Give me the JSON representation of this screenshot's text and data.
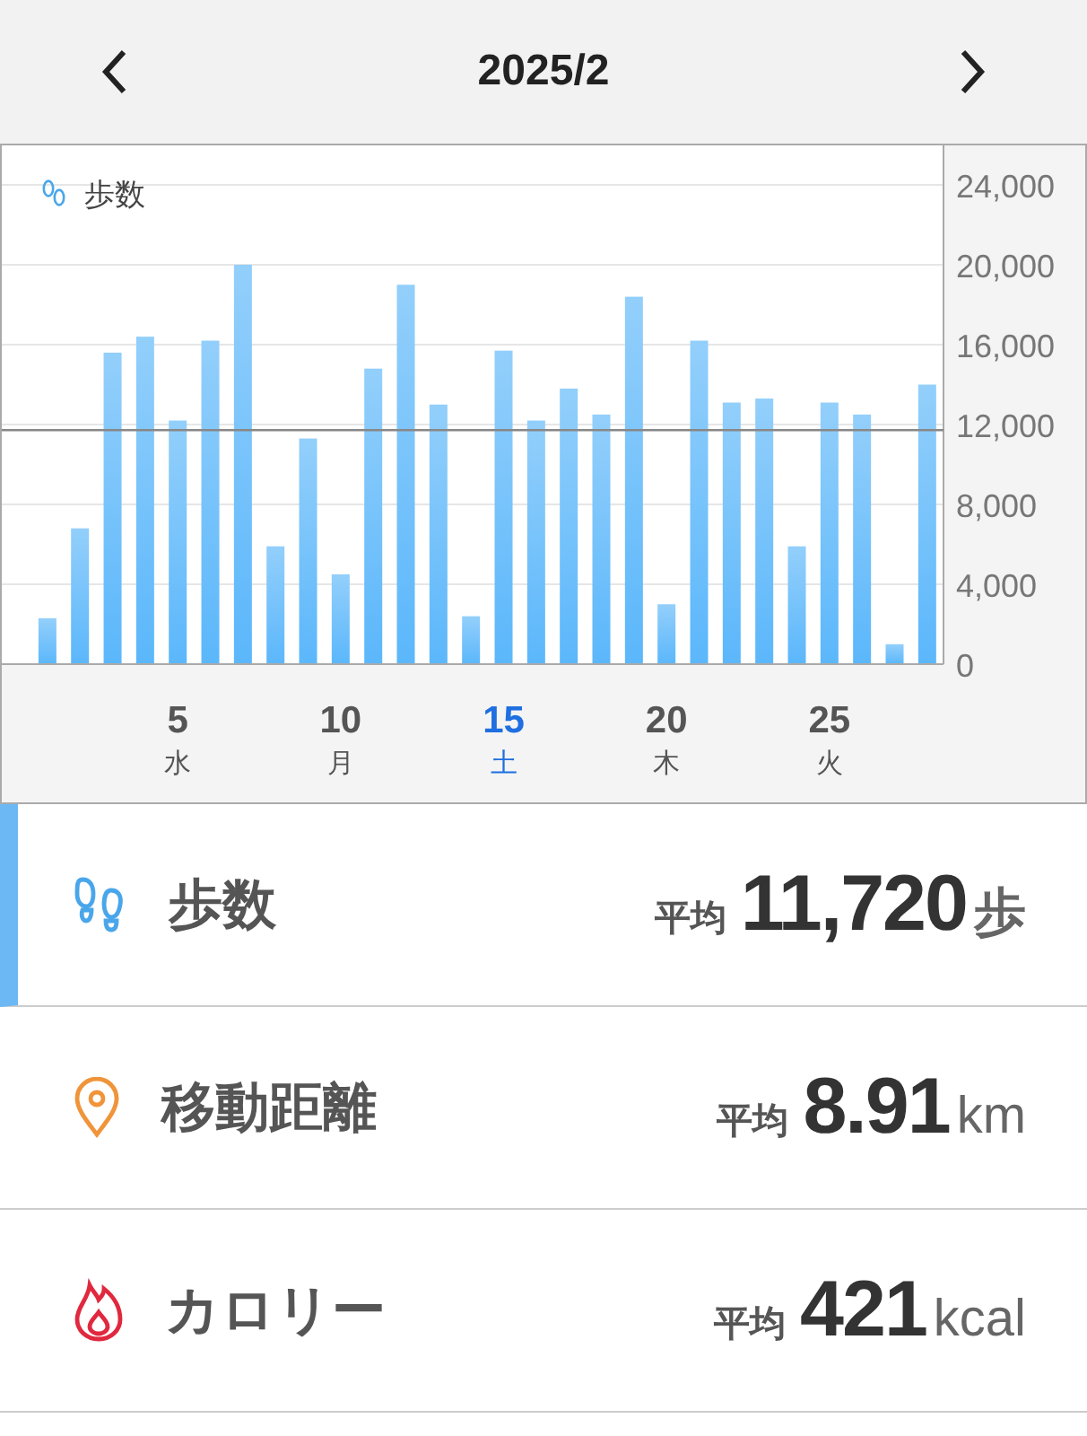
{
  "header": {
    "title": "2025/2"
  },
  "chart": {
    "chart_data": {
      "type": "bar",
      "x": [
        1,
        2,
        3,
        4,
        5,
        6,
        7,
        8,
        9,
        10,
        11,
        12,
        13,
        14,
        15,
        16,
        17,
        18,
        19,
        20,
        21,
        22,
        23,
        24,
        25,
        26,
        27,
        28
      ],
      "series": [
        {
          "name": "歩数",
          "color": "#5bb7fb",
          "values": [
            2300,
            6800,
            15600,
            16400,
            12200,
            16200,
            20000,
            5900,
            11300,
            4500,
            14800,
            19000,
            13000,
            2400,
            15700,
            12200,
            13800,
            12500,
            18400,
            3000,
            16200,
            13100,
            13300,
            5900,
            13100,
            12500,
            1000,
            14000
          ]
        }
      ],
      "xticks": [
        {
          "value": 5,
          "label": "5"
        },
        {
          "value": 10,
          "label": "10"
        },
        {
          "value": 15,
          "label": "15"
        },
        {
          "value": 20,
          "label": "20"
        },
        {
          "value": 25,
          "label": "25"
        }
      ],
      "grid": true,
      "xlim": [
        -0.4,
        28.5
      ],
      "ylim": [
        0,
        24000
      ],
      "yticks": [
        {
          "value": 0,
          "label": "0"
        },
        {
          "value": 4000,
          "label": "4,000"
        },
        {
          "value": 8000,
          "label": "8,000"
        },
        {
          "value": 12000,
          "label": "12,000"
        },
        {
          "value": 16000,
          "label": "16,000"
        },
        {
          "value": 20000,
          "label": "20,000"
        },
        {
          "value": 24000,
          "label": "24,000"
        }
      ],
      "ref_lines": [
        {
          "axis": "y",
          "value": 11720
        }
      ]
    },
    "weekday_labels": [
      {
        "weekday": "水",
        "selected": false
      },
      {
        "weekday": "月",
        "selected": false
      },
      {
        "weekday": "土",
        "selected": true
      },
      {
        "weekday": "木",
        "selected": false
      },
      {
        "weekday": "火",
        "selected": false
      }
    ]
  },
  "metrics": [
    {
      "kind": "steps",
      "label": "歩数",
      "prefix": "平均",
      "value": "11,720",
      "unit": "歩",
      "selected": true
    },
    {
      "kind": "distance",
      "label": "移動距離",
      "prefix": "平均",
      "value": "8.91",
      "unit": "km",
      "selected": false
    },
    {
      "kind": "calories",
      "label": "カロリー",
      "prefix": "平均",
      "value": "421",
      "unit": "kcal",
      "selected": false
    }
  ]
}
